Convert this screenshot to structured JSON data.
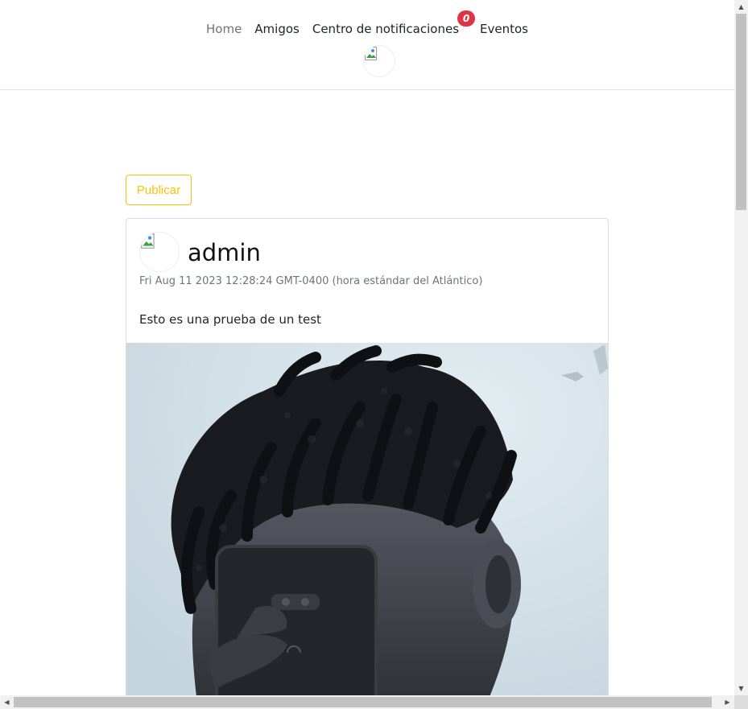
{
  "nav": {
    "items": [
      {
        "label": "Home",
        "muted": true
      },
      {
        "label": "Amigos"
      },
      {
        "label": "Centro de notificaciones",
        "badge": "0"
      },
      {
        "label": "Eventos"
      }
    ]
  },
  "actions": {
    "publish_label": "Publicar"
  },
  "post": {
    "author": "admin",
    "date": "Fri Aug 11 2023 12:28:24 GMT-0400 (hora estándar del Atlántico)",
    "text": "Esto es una prueba de un test"
  },
  "colors": {
    "accent": "#ffc107",
    "badge": "#dc3545",
    "muted_text": "#6c757d",
    "photo_background": "#d4e1e8"
  },
  "icons": {
    "nav_avatar": "broken-image-icon",
    "post_avatar": "broken-image-icon",
    "scroll_up": "triangle-up-icon",
    "scroll_down": "triangle-down-icon",
    "scroll_left": "triangle-left-icon",
    "scroll_right": "triangle-right-icon"
  }
}
